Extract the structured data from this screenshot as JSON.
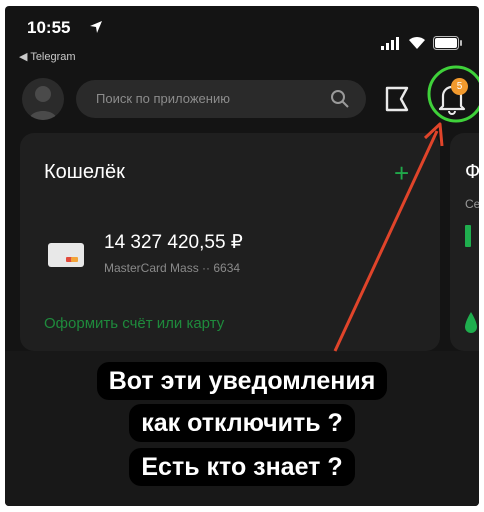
{
  "status_bar": {
    "time": "10:55",
    "back_app": "◀ Telegram"
  },
  "header": {
    "search_placeholder": "Поиск по приложению",
    "notifications_count": "5"
  },
  "wallet": {
    "title": "Кошелёк",
    "add_symbol": "+",
    "balance": "14 327 420,55 ₽",
    "card_name": "MasterCard Mass ·· 6634",
    "open_account_link": "Оформить счёт или карту"
  },
  "side_card": {
    "title_letter": "Ф",
    "subtitle": "Се"
  },
  "overlay_caption": {
    "line1": "Вот эти уведомления",
    "line2": "как отключить ?",
    "line3": "Есть кто знает ?"
  },
  "colors": {
    "accent_green": "#1f8a3c",
    "badge_orange": "#f29a2e",
    "annotation_red": "#e0442a",
    "highlight_green": "#3fd13a"
  }
}
